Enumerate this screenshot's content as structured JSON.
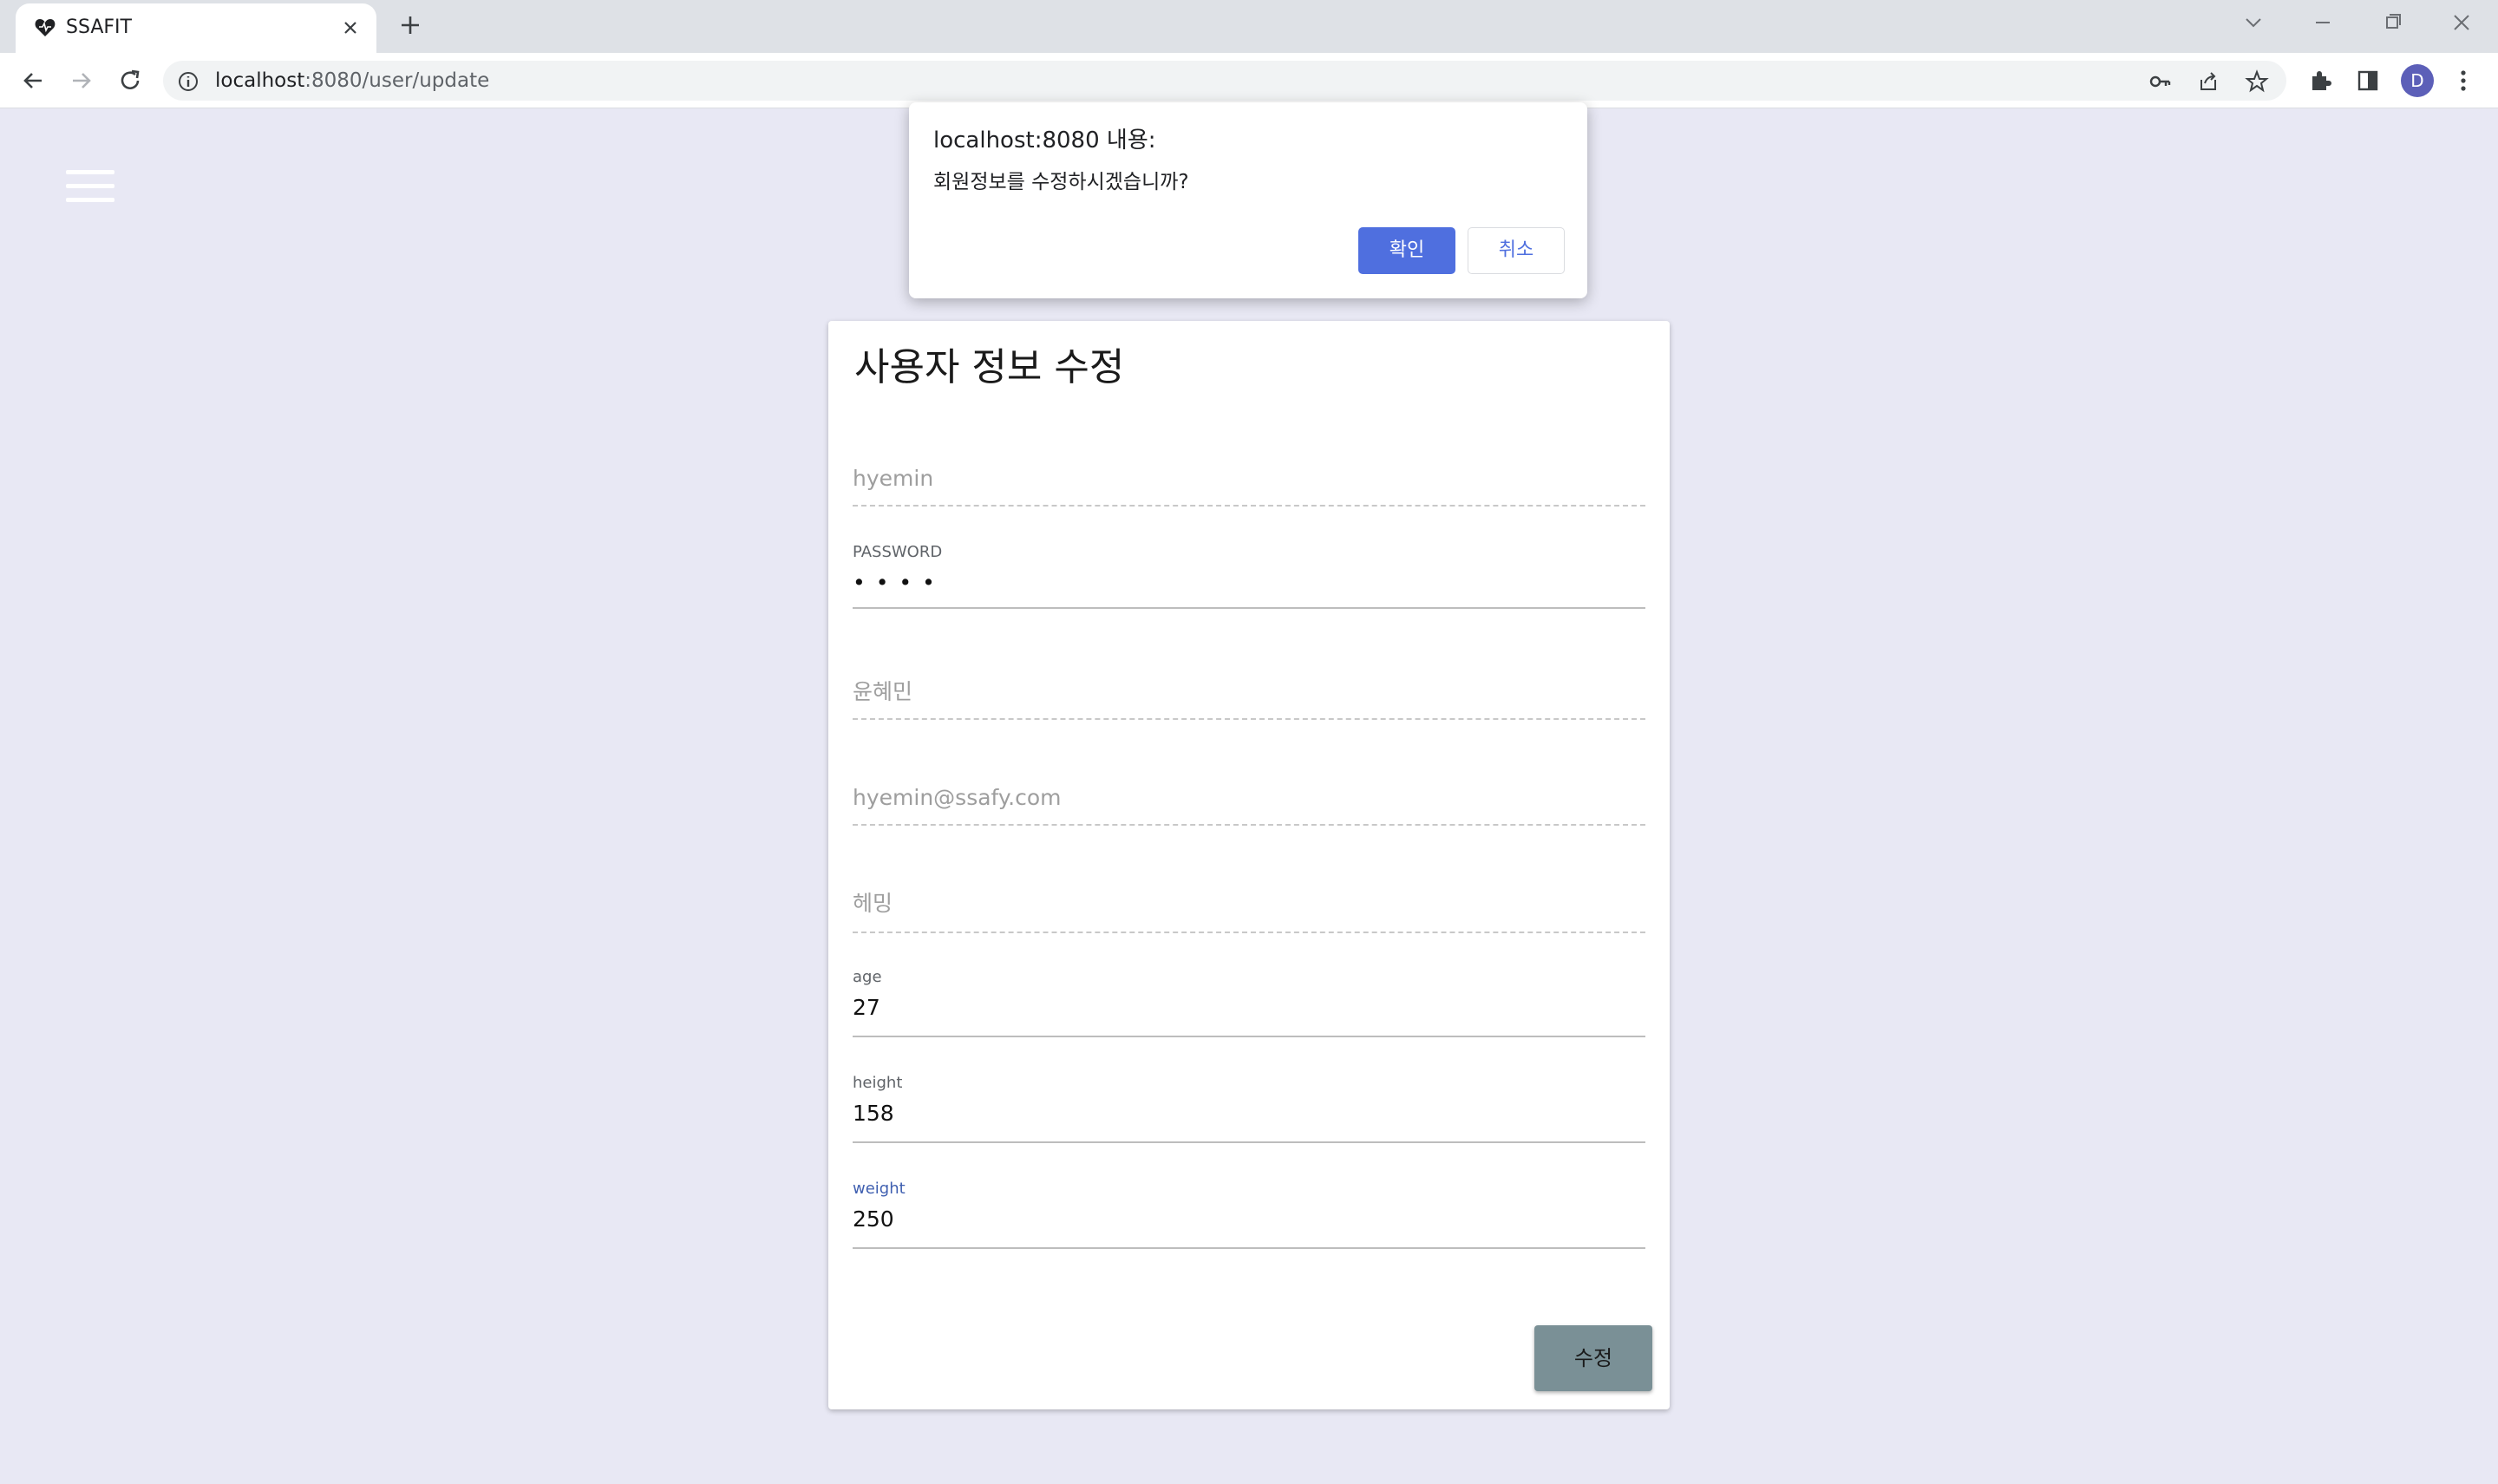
{
  "browser": {
    "tab_title": "SSAFIT",
    "url_host": "localhost",
    "url_path": ":8080/user/update",
    "profile_initial": "D"
  },
  "dialog": {
    "title": "localhost:8080 내용:",
    "message": "회원정보를 수정하시겠습니까?",
    "ok_label": "확인",
    "cancel_label": "취소"
  },
  "form": {
    "title": "사용자 정보 수정",
    "id_placeholder": "hyemin",
    "password_label": "PASSWORD",
    "password_value": "• • • •",
    "name_placeholder": "윤혜민",
    "email_placeholder": "hyemin@ssafy.com",
    "nickname_placeholder": "헤밍",
    "age_label": "age",
    "age_value": "27",
    "height_label": "height",
    "height_value": "158",
    "weight_label": "weight",
    "weight_value": "250",
    "submit_label": "수정"
  },
  "colors": {
    "accent": "#4f6fdf",
    "page_bg": "#e8e8f4",
    "submit_bg": "#7a9096",
    "focused_label": "#3f5fb0"
  }
}
